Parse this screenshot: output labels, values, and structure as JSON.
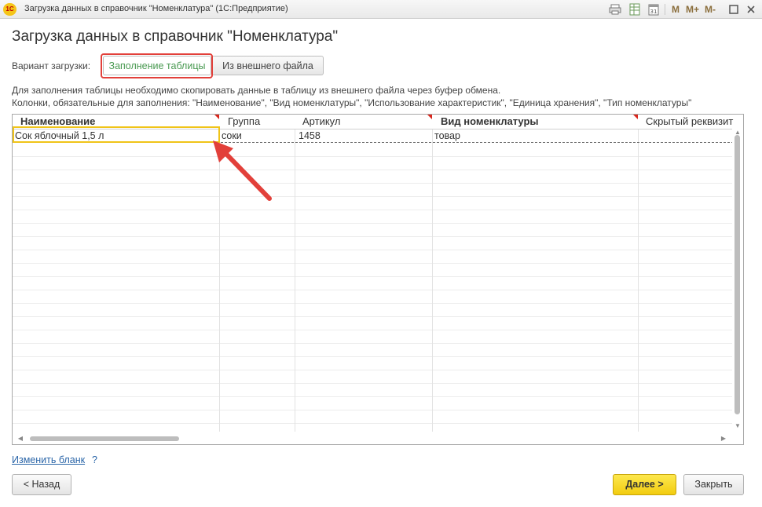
{
  "window": {
    "logo_text": "1С",
    "title": "Загрузка данных в справочник \"Номенклатура\"  (1С:Предприятие)",
    "m_label": "M",
    "m_plus_label": "M+",
    "m_minus_label": "M-"
  },
  "form": {
    "title": "Загрузка данных в справочник \"Номенклатура\""
  },
  "variant": {
    "label": "Вариант загрузки:",
    "options": [
      {
        "label": "Заполнение таблицы",
        "selected": true
      },
      {
        "label": "Из внешнего файла",
        "selected": false
      }
    ]
  },
  "info": {
    "line1": "Для заполнения таблицы необходимо скопировать данные в таблицу из внешнего файла через буфер обмена.",
    "line2": "Колонки, обязательные для заполнения: \"Наименование\", \"Вид номенклатуры\", \"Использование характеристик\", \"Единица хранения\", \"Тип номенклатуры\""
  },
  "table": {
    "columns": [
      {
        "label": "Наименование",
        "required": true,
        "bold": true
      },
      {
        "label": "Группа",
        "required": false,
        "bold": false
      },
      {
        "label": "Артикул",
        "required": true,
        "bold": false
      },
      {
        "label": "Вид номенклатуры",
        "required": true,
        "bold": true
      },
      {
        "label": "Скрытый реквизит",
        "required": false,
        "bold": false
      }
    ],
    "rows": [
      [
        "Сок яблочный 1,5 л",
        "соки",
        "1458",
        "товар",
        ""
      ]
    ]
  },
  "footer": {
    "change_form_link": "Изменить бланк",
    "help": "?",
    "back_button": "< Назад",
    "next_button": "Далее >",
    "close_button": "Закрыть"
  },
  "colors": {
    "accent_yellow": "#f2cc10",
    "highlight_red": "#e2403a",
    "active_green": "#4a9a52",
    "link_blue": "#2a65a8"
  }
}
